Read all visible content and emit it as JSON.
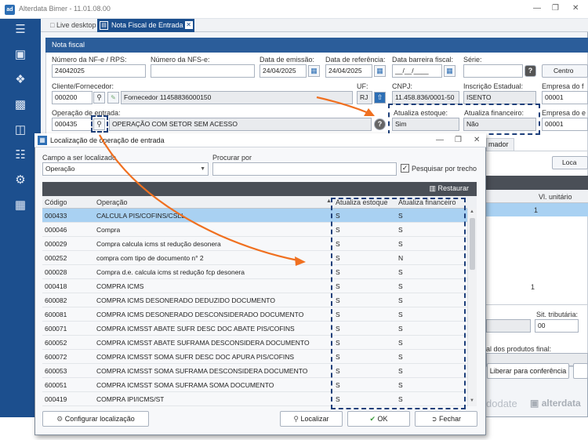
{
  "app": {
    "title": "Alterdata Bimer - 11.01.08.00"
  },
  "tabs": [
    {
      "label": "Live desktop"
    },
    {
      "label": "Nota Fiscal de Entrada"
    }
  ],
  "form": {
    "header": "Nota fiscal",
    "numero_nf_label": "Número da NF-e / RPS:",
    "numero_nf_value": "24042025",
    "numero_nfse_label": "Número da NFS-e:",
    "numero_nfse_value": "",
    "data_emissao_label": "Data de emissão:",
    "data_emissao_value": "24/04/2025",
    "data_referencia_label": "Data de referência:",
    "data_referencia_value": "24/04/2025",
    "data_barreira_label": "Data barreira fiscal:",
    "data_barreira_value": "__/__/____",
    "serie_label": "Série:",
    "serie_value": "",
    "centro_label": "Centro",
    "cliente_label": "Cliente/Fornecedor:",
    "cliente_code": "000200",
    "cliente_name": "Fornecedor 11458836000150",
    "uf_label": "UF:",
    "uf_value": "RJ",
    "cnpj_label": "CNPJ:",
    "cnpj_value": "11.458.836/0001-50",
    "inscricao_label": "Inscrição Estadual:",
    "inscricao_value": "ISENTO",
    "empresa_label": "Empresa do f",
    "empresa_value": "00001",
    "empresa2_label": "Empresa do e",
    "empresa2_value": "00001",
    "operacao_label": "Operação de entrada:",
    "operacao_code": "000435",
    "operacao_name": "OPERAÇÃO COM SETOR SEM ACESSO",
    "atualiza_estoque_label": "Atualiza estoque:",
    "atualiza_estoque_value": "Sim",
    "atualiza_financeiro_label": "Atualiza financeiro:",
    "atualiza_financeiro_value": "Não"
  },
  "background": {
    "tab_partial": "mador",
    "localizar_partial": "Loca",
    "vl_unitario": "Vl. unitário",
    "qty1": "1",
    "qty2": "1",
    "sit_tributaria_label": "Sit. tributária:",
    "sit_tributaria_value": "00",
    "total_label": "al dos produtos final:",
    "liberar_button": "Liberar para conferência",
    "watermark": "dodate",
    "brand": "alterdata"
  },
  "dialog": {
    "title": "Localização de operação de entrada",
    "campo_label": "Campo a ser localizado",
    "campo_value": "Operação",
    "procurar_label": "Procurar por",
    "procurar_value": "",
    "pesquisar_label": "Pesquisar por trecho",
    "pesquisar_checked": true,
    "restaurar_label": "Restaurar",
    "columns": [
      "Código",
      "Operação",
      "Atualiza estoque",
      "Atualiza financeiro"
    ],
    "rows": [
      {
        "codigo": "000433",
        "operacao": "CALCULA PIS/COFINS/CSLL",
        "estoque": "S",
        "financeiro": "S",
        "selected": true
      },
      {
        "codigo": "000046",
        "operacao": "Compra",
        "estoque": "S",
        "financeiro": "S"
      },
      {
        "codigo": "000029",
        "operacao": "Compra calcula icms st redução desonera",
        "estoque": "S",
        "financeiro": "S"
      },
      {
        "codigo": "000252",
        "operacao": "compra com tipo de documento n° 2",
        "estoque": "S",
        "financeiro": "N"
      },
      {
        "codigo": "000028",
        "operacao": "Compra d.e. calcula icms st redução fcp desonera",
        "estoque": "S",
        "financeiro": "S"
      },
      {
        "codigo": "000418",
        "operacao": "COMPRA ICMS",
        "estoque": "S",
        "financeiro": "S"
      },
      {
        "codigo": "600082",
        "operacao": "COMPRA ICMS DESONERADO DEDUZIDO DOCUMENTO",
        "estoque": "S",
        "financeiro": "S"
      },
      {
        "codigo": "600081",
        "operacao": "COMPRA ICMS DESONERADO DESCONSIDERADO DOCUMENTO",
        "estoque": "S",
        "financeiro": "S"
      },
      {
        "codigo": "600071",
        "operacao": "COMPRA ICMSST ABATE SUFR DESC DOC ABATE PIS/COFINS",
        "estoque": "S",
        "financeiro": "S"
      },
      {
        "codigo": "600052",
        "operacao": "COMPRA ICMSST ABATE SUFRAMA DESCONSIDERA DOCUMENTO",
        "estoque": "S",
        "financeiro": "S"
      },
      {
        "codigo": "600072",
        "operacao": "COMPRA ICMSST SOMA SUFR DESC DOC APURA PIS/COFINS",
        "estoque": "S",
        "financeiro": "S"
      },
      {
        "codigo": "600053",
        "operacao": "COMPRA ICMSST SOMA SUFRAMA DESCONSIDERA DOCUMENTO",
        "estoque": "S",
        "financeiro": "S"
      },
      {
        "codigo": "600051",
        "operacao": "COMPRA ICMSST SOMA SUFRAMA SOMA DOCUMENTO",
        "estoque": "S",
        "financeiro": "S"
      },
      {
        "codigo": "000419",
        "operacao": "COMPRA IPI/ICMS/ST",
        "estoque": "S",
        "financeiro": "S"
      }
    ],
    "configurar_button": "Configurar localização",
    "localizar_button": "Localizar",
    "ok_button": "OK",
    "fechar_button": "Fechar"
  },
  "colors": {
    "brand_blue": "#1c4f8e",
    "header_blue": "#2b5d9a",
    "highlight": "#a9d1f2",
    "arrow_orange": "#f07020",
    "dash_navy": "#1d3f7a"
  }
}
